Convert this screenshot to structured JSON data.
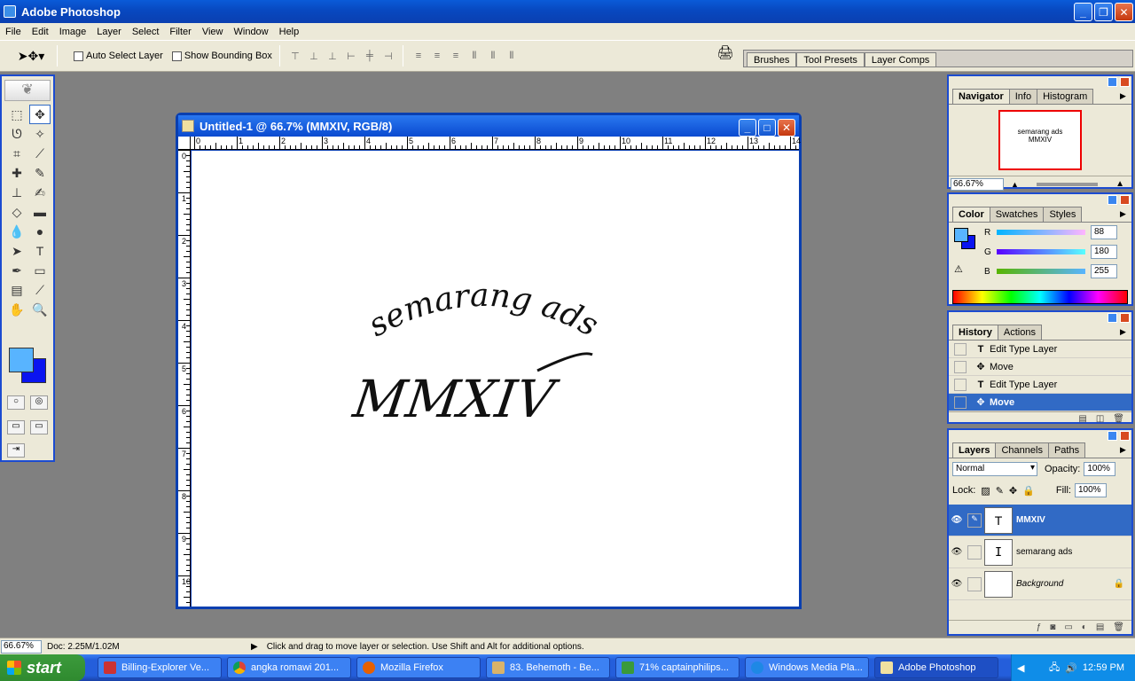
{
  "app": {
    "title": "Adobe Photoshop"
  },
  "menu": [
    "File",
    "Edit",
    "Image",
    "Layer",
    "Select",
    "Filter",
    "View",
    "Window",
    "Help"
  ],
  "options": {
    "auto_select_layer": "Auto Select Layer",
    "show_bounding_box": "Show Bounding Box",
    "palette_well_tabs": [
      "Brushes",
      "Tool Presets",
      "Layer Comps"
    ]
  },
  "document": {
    "title": "Untitled-1 @ 66.7% (MMXIV, RGB/8)",
    "ruler_h": [
      "0",
      "1",
      "2",
      "3",
      "4",
      "5",
      "6",
      "7",
      "8",
      "9",
      "10",
      "11",
      "12",
      "13",
      "14"
    ],
    "ruler_v": [
      "0",
      "1",
      "2",
      "3",
      "4",
      "5",
      "6",
      "7",
      "8",
      "9",
      "10"
    ],
    "text_arc": "semarang ads",
    "text_main": "MMXIV"
  },
  "navigator": {
    "tabs": [
      "Navigator",
      "Info",
      "Histogram"
    ],
    "zoom": "66.67%"
  },
  "color": {
    "tabs": [
      "Color",
      "Swatches",
      "Styles"
    ],
    "r_label": "R",
    "g_label": "G",
    "b_label": "B",
    "r": "88",
    "g": "180",
    "b": "255",
    "fg": "#58b4ff",
    "bg": "#0a14f0"
  },
  "history": {
    "tabs": [
      "History",
      "Actions"
    ],
    "items": [
      {
        "label": "Edit Type Layer",
        "icon": "type-icon"
      },
      {
        "label": "Move",
        "icon": "move-icon"
      },
      {
        "label": "Edit Type Layer",
        "icon": "type-icon"
      },
      {
        "label": "Move",
        "icon": "move-icon"
      }
    ]
  },
  "layers": {
    "tabs": [
      "Layers",
      "Channels",
      "Paths"
    ],
    "blend_mode": "Normal",
    "opacity_label": "Opacity:",
    "opacity": "100%",
    "lock_label": "Lock:",
    "fill_label": "Fill:",
    "fill": "100%",
    "items": [
      {
        "name": "MMXIV"
      },
      {
        "name": "semarang ads"
      },
      {
        "name": "Background"
      }
    ]
  },
  "status": {
    "zoom": "66.67%",
    "doc": "Doc: 2.25M/1.02M",
    "hint": "Click and drag to move layer or selection.  Use Shift and Alt for additional options."
  },
  "taskbar": {
    "start": "start",
    "tasks": [
      "Billing-Explorer Ve...",
      "angka romawi 201...",
      "Mozilla Firefox",
      "83. Behemoth - Be...",
      "71% captainphilips...",
      "Windows Media Pla...",
      "Adobe Photoshop"
    ],
    "clock": "12:59 PM"
  }
}
